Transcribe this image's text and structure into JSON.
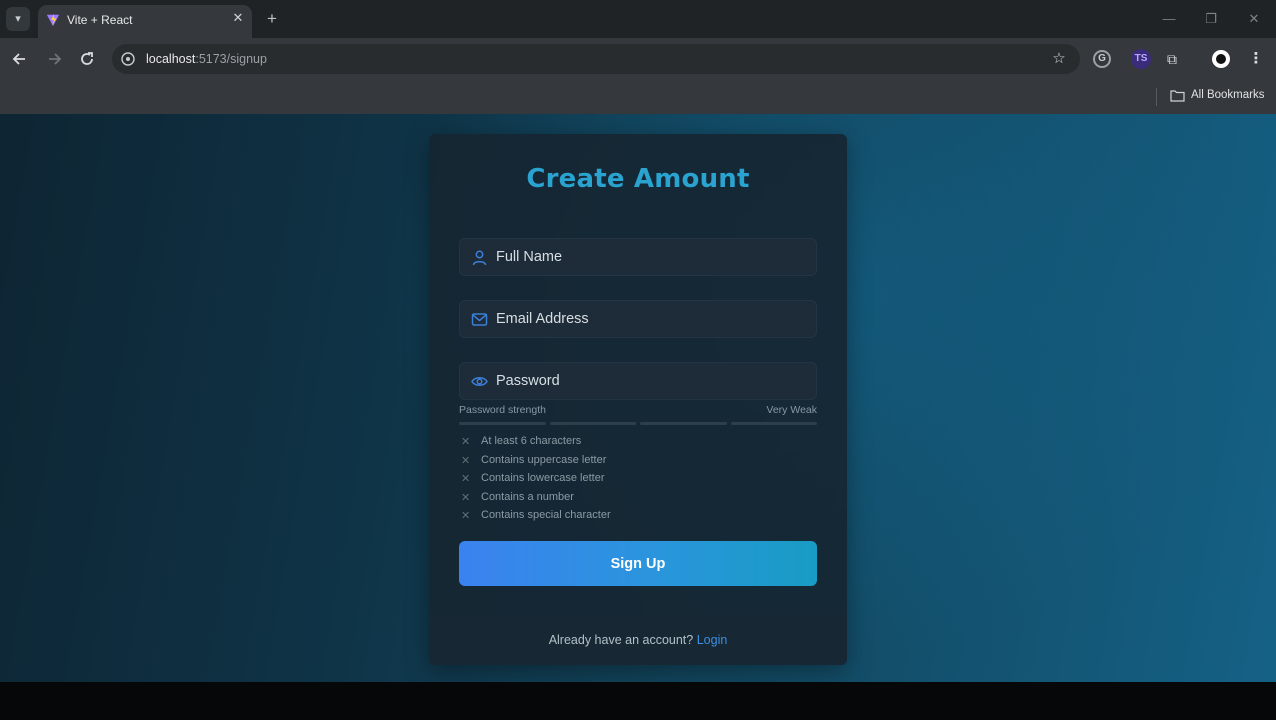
{
  "browser": {
    "tab_title": "Vite + React",
    "tab_close": "✕",
    "new_tab": "+",
    "url_host": "localhost",
    "url_rest": ":5173/signup",
    "bookmarks_label": "All Bookmarks",
    "window_controls": {
      "minimize": "—",
      "maximize": "❐",
      "close": "✕"
    },
    "icons": [
      "tab-list-icon",
      "vite-favicon",
      "back-icon",
      "forward-icon",
      "reload-icon",
      "site-info-icon",
      "star-icon",
      "extension-icon",
      "profile-icon",
      "puzzle-icon",
      "menu-icon",
      "folder-icon"
    ]
  },
  "form": {
    "title": "Create Amount",
    "fields": {
      "full_name_placeholder": "Full Name",
      "email_placeholder": "Email Address",
      "password_placeholder": "Password"
    },
    "strength": {
      "label": "Password strength",
      "value": "Very Weak",
      "segments_total": 4,
      "segments_filled": 0
    },
    "requirements": [
      "At least 6 characters",
      "Contains uppercase letter",
      "Contains lowercase letter",
      "Contains a number",
      "Contains special character"
    ],
    "requirement_icon": "✕",
    "submit_label": "Sign Up",
    "footer_text": "Already have an account?",
    "footer_link": "Login"
  },
  "colors": {
    "title": "#2aa3d0",
    "accent": "#3b82f0",
    "link": "#3d8fe0",
    "icon": "#3d7fd6"
  }
}
